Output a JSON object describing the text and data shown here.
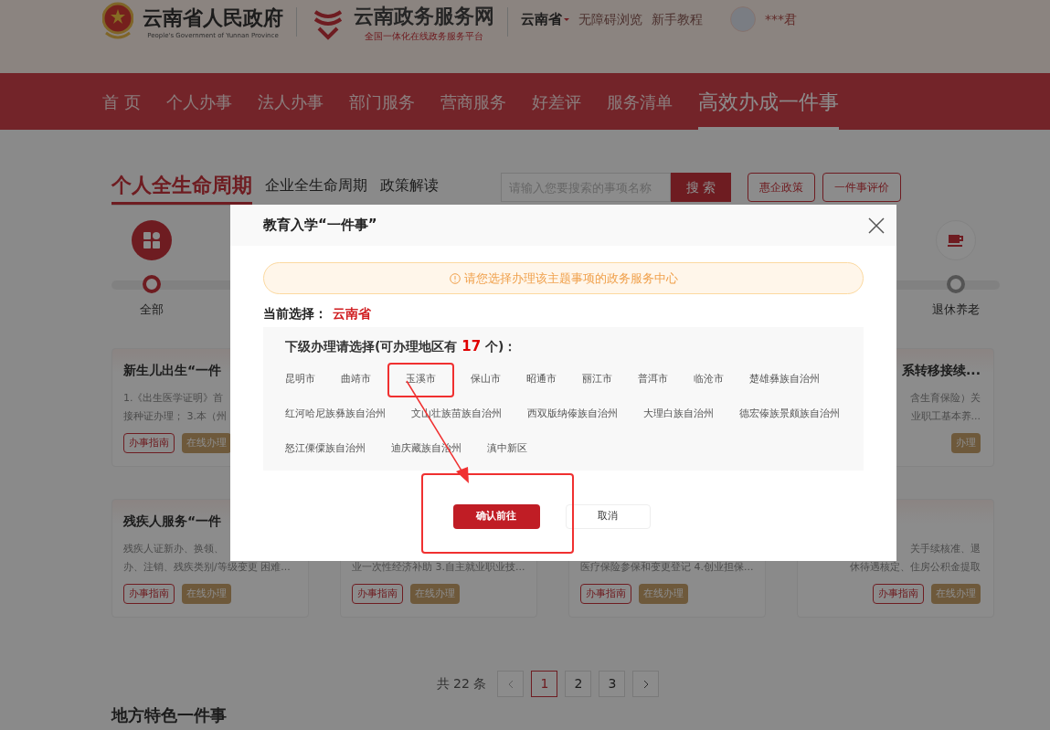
{
  "header": {
    "gov_name": "云南省人民政府",
    "gov_name_en": "People's Government of Yunnan Province",
    "portal_name": "云南政务服务网",
    "portal_slogan": "全国一体化在线政务服务平台",
    "region": "云南省",
    "links": [
      "无障碍浏览",
      "新手教程"
    ],
    "user": "***君"
  },
  "nav": [
    {
      "label": "首 页",
      "selected": false
    },
    {
      "label": "个人办事",
      "selected": false
    },
    {
      "label": "法人办事",
      "selected": false
    },
    {
      "label": "部门服务",
      "selected": false
    },
    {
      "label": "营商服务",
      "selected": false
    },
    {
      "label": "好差评",
      "selected": false
    },
    {
      "label": "服务清单",
      "selected": false
    },
    {
      "label": "高效办成一件事",
      "selected": true
    }
  ],
  "section_tabs": [
    {
      "label": "个人全生命周期",
      "selected": true
    },
    {
      "label": "企业全生命周期",
      "selected": false
    },
    {
      "label": "政策解读",
      "selected": false
    }
  ],
  "search": {
    "placeholder": "请输入您要搜索的事项名称",
    "button": "搜 索"
  },
  "action_buttons": [
    "惠企政策",
    "一件事评价"
  ],
  "categories": [
    {
      "label": "全部",
      "selected": true,
      "kind": "grid"
    },
    {
      "label": "退休养老",
      "selected": false,
      "kind": "cup"
    }
  ],
  "card_rows": [
    {
      "cards": [
        {
          "title": "新生儿出生“一件",
          "description": [
            "1.《出生医学证明》首",
            "接种证办理； 3.本（州"
          ],
          "buttons": [
            "办事指南",
            "在线办理"
          ]
        },
        {
          "title": "系转移接续...",
          "description": [
            "含生育保险）关",
            "业职工基本养..."
          ],
          "buttons": [
            "办理"
          ]
        }
      ]
    },
    {
      "cards": [
        {
          "title": "残疾人服务“一件",
          "description": [
            "残疾人证新办、换领、",
            "办、注销、残疾类别/等级变更 困难..."
          ],
          "buttons": [
            "办事指南",
            "在线办理"
          ]
        },
        {
          "description": [
            "业一次性经济补助 3.自主就业职业技..."
          ],
          "buttons": [
            "办事指南",
            "在线办理"
          ]
        },
        {
          "description": [
            "医疗保险参保和变更登记 4.创业担保..."
          ],
          "buttons": [
            "办事指南",
            "在线办理"
          ]
        },
        {
          "description": [
            "关手续核准、退",
            "休待遇核定、住房公积金提取"
          ],
          "buttons": [
            "办事指南",
            "在线办理"
          ]
        }
      ]
    }
  ],
  "pagination": {
    "total": "共 22 条",
    "pages": [
      {
        "label": "1",
        "selected": true
      },
      {
        "label": "2",
        "selected": false
      },
      {
        "label": "3",
        "selected": false
      }
    ]
  },
  "next_section_title": "地方特色一件事",
  "dialog": {
    "title": "教育入学“一件事”",
    "notice": "请您选择办理该主题事项的政务服务中心",
    "current_label": "当前选择：",
    "current_value": "云南省",
    "regions_heading": "下级办理请选择(可办理地区有",
    "regions_count": "17",
    "regions_heading_suffix": "个)：",
    "regions": [
      {
        "name": "昆明市",
        "selected": false
      },
      {
        "name": "曲靖市",
        "selected": false
      },
      {
        "name": "玉溪市",
        "selected": true
      },
      {
        "name": "保山市",
        "selected": false
      },
      {
        "name": "昭通市",
        "selected": false
      },
      {
        "name": "丽江市",
        "selected": false
      },
      {
        "name": "普洱市",
        "selected": false
      },
      {
        "name": "临沧市",
        "selected": false
      },
      {
        "name": "楚雄彝族自治州",
        "selected": false
      },
      {
        "name": "红河哈尼族彝族自治州",
        "selected": false
      },
      {
        "name": "文山壮族苗族自治州",
        "selected": false
      },
      {
        "name": "西双版纳傣族自治州",
        "selected": false
      },
      {
        "name": "大理白族自治州",
        "selected": false
      },
      {
        "name": "德宏傣族景颇族自治州",
        "selected": false
      },
      {
        "name": "怒江傈僳族自治州",
        "selected": false
      },
      {
        "name": "迪庆藏族自治州",
        "selected": false
      },
      {
        "name": "滇中新区",
        "selected": false
      }
    ],
    "confirm": "确认前往",
    "cancel": "取消"
  }
}
